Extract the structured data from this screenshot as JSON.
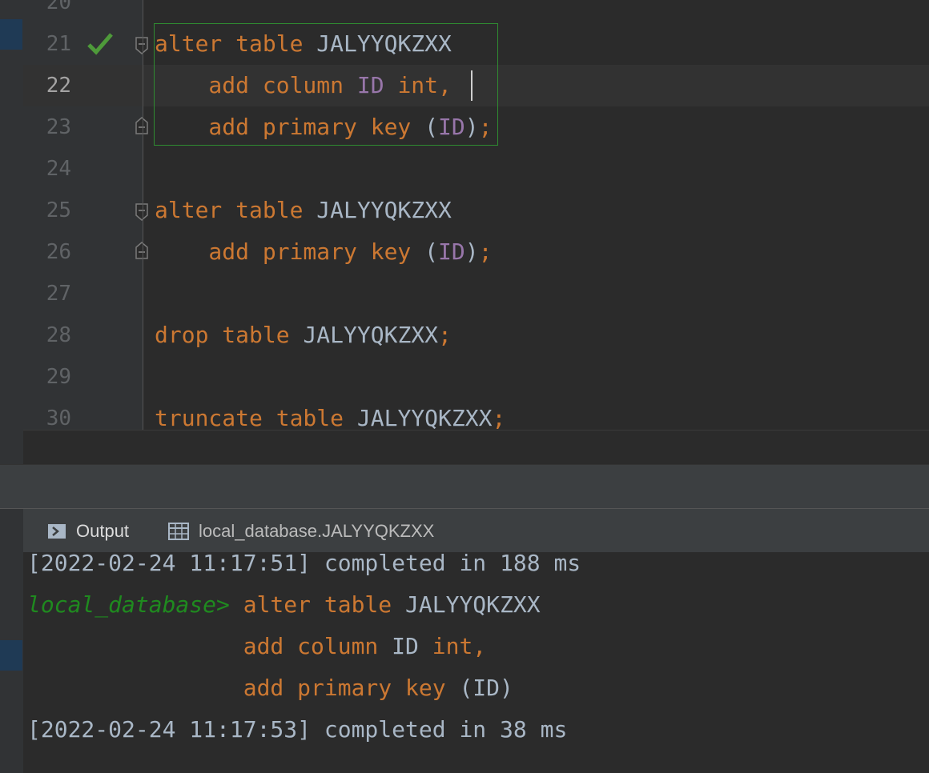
{
  "editor": {
    "lines": [
      {
        "num": "20"
      },
      {
        "num": "21",
        "parts": [
          [
            "kw",
            "alter table "
          ],
          [
            "id",
            "JALYYQKZXX"
          ]
        ]
      },
      {
        "num": "22",
        "parts": [
          [
            "kw",
            "    add column "
          ],
          [
            "col",
            "ID"
          ],
          [
            "kw",
            " int,"
          ]
        ]
      },
      {
        "num": "23",
        "parts": [
          [
            "kw",
            "    add primary key "
          ],
          [
            "id",
            "("
          ],
          [
            "col",
            "ID"
          ],
          [
            "id",
            ")"
          ],
          [
            "kw",
            ";"
          ]
        ]
      },
      {
        "num": "24"
      },
      {
        "num": "25",
        "parts": [
          [
            "kw",
            "alter table "
          ],
          [
            "id",
            "JALYYQKZXX"
          ]
        ]
      },
      {
        "num": "26",
        "parts": [
          [
            "kw",
            "    add primary key "
          ],
          [
            "id",
            "("
          ],
          [
            "col",
            "ID"
          ],
          [
            "id",
            ")"
          ],
          [
            "kw",
            ";"
          ]
        ]
      },
      {
        "num": "27"
      },
      {
        "num": "28",
        "parts": [
          [
            "kw",
            "drop table "
          ],
          [
            "id",
            "JALYYQKZXX"
          ],
          [
            "kw",
            ";"
          ]
        ]
      },
      {
        "num": "29"
      },
      {
        "num": "30",
        "parts": [
          [
            "kw",
            "truncate table "
          ],
          [
            "id",
            "JALYYQKZXX"
          ],
          [
            "kw",
            ";"
          ]
        ]
      }
    ],
    "current_line": "22",
    "executed_marker_line": "21"
  },
  "tabs": [
    {
      "label": "Output",
      "icon": "console-icon",
      "active": true
    },
    {
      "label": "local_database.JALYYQKZXX",
      "icon": "table-grid-icon",
      "active": false
    }
  ],
  "console": {
    "lines": [
      {
        "parts": [
          [
            "plain",
            "[2022-02-24 11:17:51] completed in 188 ms"
          ]
        ]
      },
      {
        "parts": [
          [
            "prompt",
            "local_database> "
          ],
          [
            "kw",
            "alter table "
          ],
          [
            "plain",
            "JALYYQKZXX"
          ]
        ]
      },
      {
        "parts": [
          [
            "plain",
            "                "
          ],
          [
            "kw",
            "add column "
          ],
          [
            "plain",
            "ID "
          ],
          [
            "kw",
            "int,"
          ]
        ]
      },
      {
        "parts": [
          [
            "plain",
            "                "
          ],
          [
            "kw",
            "add primary key "
          ],
          [
            "plain",
            "(ID)"
          ]
        ]
      },
      {
        "parts": [
          [
            "plain",
            "[2022-02-24 11:17:53] completed in 38 ms"
          ]
        ]
      }
    ]
  },
  "colors": {
    "keyword": "#cc7832",
    "identifier": "#a9b7c6",
    "column": "#9876aa",
    "prompt": "#1f8a1f",
    "selection_border": "#2f8b31"
  }
}
